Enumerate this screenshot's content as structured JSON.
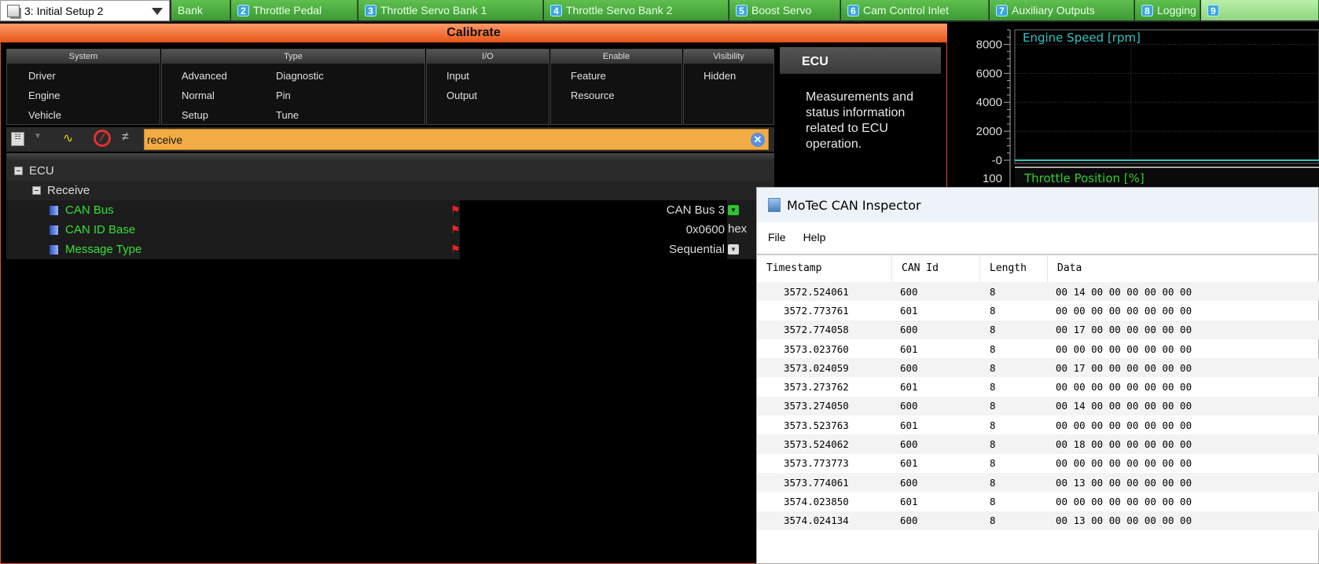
{
  "workspace": {
    "selected": "3: Initial Setup 2"
  },
  "tabs": [
    {
      "num": "",
      "label": "Bank"
    },
    {
      "num": "2",
      "label": "Throttle Pedal"
    },
    {
      "num": "3",
      "label": "Throttle Servo Bank 1"
    },
    {
      "num": "4",
      "label": "Throttle Servo Bank 2"
    },
    {
      "num": "5",
      "label": "Boost Servo"
    },
    {
      "num": "6",
      "label": "Cam Control Inlet"
    },
    {
      "num": "7",
      "label": "Auxiliary Outputs"
    },
    {
      "num": "8",
      "label": "Logging"
    },
    {
      "num": "9",
      "label": ""
    }
  ],
  "calibrate": {
    "title": "Calibrate",
    "filters": {
      "system": {
        "header": "System",
        "items": [
          "Driver",
          "Engine",
          "Vehicle"
        ]
      },
      "type": {
        "header": "Type",
        "items": [
          "Advanced",
          "Normal",
          "Setup",
          "Diagnostic",
          "Pin",
          "Tune"
        ]
      },
      "io": {
        "header": "I/O",
        "items": [
          "Input",
          "Output"
        ]
      },
      "enable": {
        "header": "Enable",
        "items": [
          "Feature",
          "Resource"
        ]
      },
      "visibility": {
        "header": "Visibility",
        "items": [
          "Hidden"
        ]
      }
    },
    "search": {
      "value": "receive"
    },
    "info": {
      "title": "ECU",
      "text": "Measurements and status information related to ECU operation."
    },
    "tree": {
      "root": "ECU",
      "group": "Receive",
      "rows": [
        {
          "label": "CAN Bus",
          "value": "CAN Bus 3",
          "control": "green-dropdown"
        },
        {
          "label": "CAN ID Base",
          "value": "0x0600",
          "unit": "hex"
        },
        {
          "label": "Message Type",
          "value": "Sequential",
          "control": "dropdown"
        }
      ]
    }
  },
  "chart_data": [
    {
      "type": "line",
      "title": "Engine Speed [rpm]",
      "yticks": [
        "8000",
        "6000",
        "4000",
        "2000",
        "-0"
      ],
      "ylim": [
        0,
        9000
      ],
      "series": [
        {
          "values": [
            0,
            0
          ]
        }
      ],
      "color": "#2ec4c4",
      "grid": true
    },
    {
      "type": "line",
      "title": "Throttle Position [%]",
      "yticks": [
        "100"
      ],
      "color": "#2fd02f"
    }
  ],
  "can_inspector": {
    "title": "MoTeC CAN Inspector",
    "menu": [
      "File",
      "Help"
    ],
    "columns": [
      "Timestamp",
      "CAN Id",
      "Length",
      "Data"
    ],
    "rows": [
      [
        "3572.524061",
        "600",
        "8",
        "00 14 00 00 00 00 00 00"
      ],
      [
        "3572.773761",
        "601",
        "8",
        "00 00 00 00 00 00 00 00"
      ],
      [
        "3572.774058",
        "600",
        "8",
        "00 17 00 00 00 00 00 00"
      ],
      [
        "3573.023760",
        "601",
        "8",
        "00 00 00 00 00 00 00 00"
      ],
      [
        "3573.024059",
        "600",
        "8",
        "00 17 00 00 00 00 00 00"
      ],
      [
        "3573.273762",
        "601",
        "8",
        "00 00 00 00 00 00 00 00"
      ],
      [
        "3573.274050",
        "600",
        "8",
        "00 14 00 00 00 00 00 00"
      ],
      [
        "3573.523763",
        "601",
        "8",
        "00 00 00 00 00 00 00 00"
      ],
      [
        "3573.524062",
        "600",
        "8",
        "00 18 00 00 00 00 00 00"
      ],
      [
        "3573.773773",
        "601",
        "8",
        "00 00 00 00 00 00 00 00"
      ],
      [
        "3573.774061",
        "600",
        "8",
        "00 13 00 00 00 00 00 00"
      ],
      [
        "3574.023850",
        "601",
        "8",
        "00 00 00 00 00 00 00 00"
      ],
      [
        "3574.024134",
        "600",
        "8",
        "00 13 00 00 00 00 00 00"
      ]
    ]
  }
}
